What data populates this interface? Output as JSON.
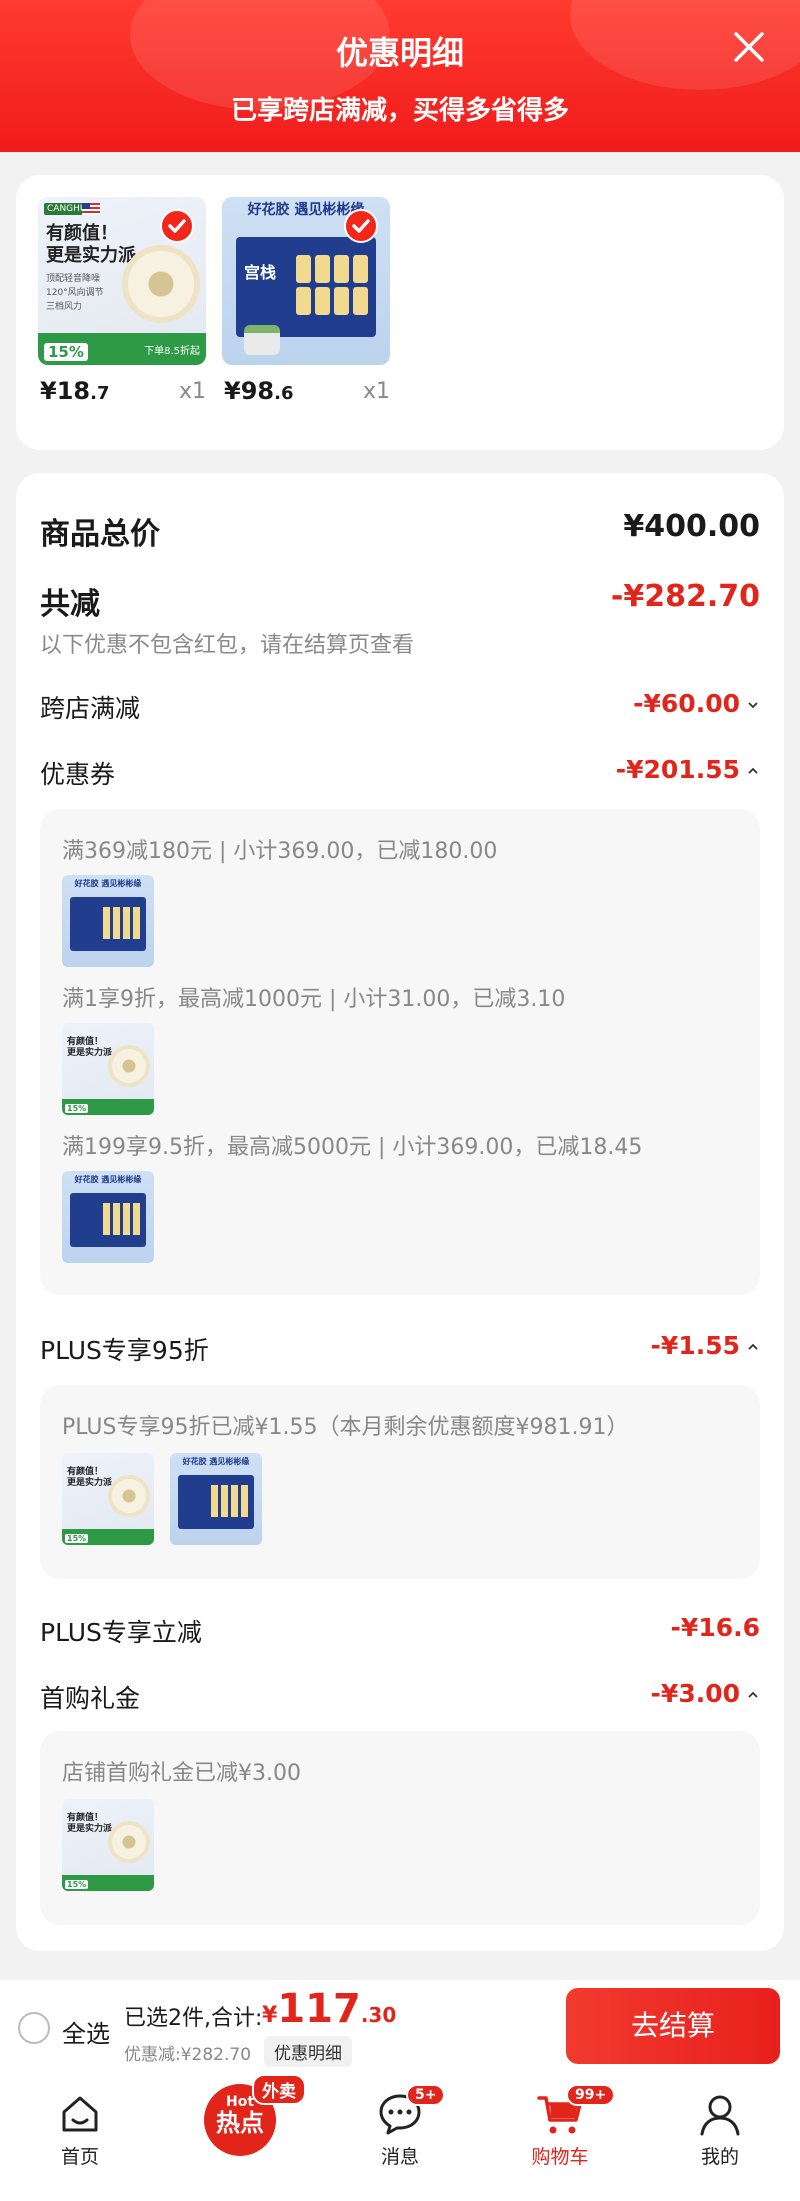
{
  "header": {
    "title": "优惠明细",
    "subtitle": "已享跨店满减，买得多省得多",
    "accent": "#f01b1b"
  },
  "products": [
    {
      "price_symbol": "¥",
      "price_int": "18",
      "price_dec": ".7",
      "qty": "x1",
      "checked": true,
      "art": {
        "brand": "CANGHUA",
        "headline_1": "有颜值！",
        "headline_2": "更是实力派",
        "bullets": [
          "顶配轻音降噪",
          "120°风向调节",
          "三档风力"
        ],
        "badge": "15%",
        "band_text": "下单8.5折起"
      }
    },
    {
      "price_symbol": "¥",
      "price_int": "98",
      "price_dec": ".6",
      "qty": "x1",
      "checked": true,
      "art": {
        "top_text": "好花胶 遇见彬彬缘",
        "pack_name": "宫栈"
      }
    }
  ],
  "summary": {
    "total_label": "商品总价",
    "total_value": "¥400.00",
    "reduce_label": "共减",
    "reduce_value": "-¥282.70",
    "reduce_note": "以下优惠不包含红包，请在结算页查看",
    "items": [
      {
        "label": "跨店满减",
        "value": "-¥60.00",
        "expanded": false
      },
      {
        "label": "优惠券",
        "value": "-¥201.55",
        "expanded": true
      },
      {
        "label": "PLUS专享95折",
        "value": "-¥1.55",
        "expanded": true
      },
      {
        "label": "PLUS专享立减",
        "value": "-¥16.6",
        "expanded": false
      },
      {
        "label": "首购礼金",
        "value": "-¥3.00",
        "expanded": true
      }
    ]
  },
  "coupon_panel": [
    {
      "text": "满369减180元 | 小计369.00，已减180.00",
      "product": "box"
    },
    {
      "text": "满1享9折，最高减1000元 | 小计31.00，已减3.10",
      "product": "fan"
    },
    {
      "text": "满199享9.5折，最高减5000元 | 小计369.00，已减18.45",
      "product": "box"
    }
  ],
  "plus_panel": {
    "text": "PLUS专享95折已减¥1.55（本月剩余优惠额度¥981.91）"
  },
  "gift_panel": {
    "text": "店铺首购礼金已减¥3.00"
  },
  "bottom_bar": {
    "select_all": "全选",
    "selected": "已选2件,合计:",
    "total_symbol": "¥",
    "total_int": "117",
    "total_dec": ".30",
    "discount": "优惠减:¥282.70",
    "detail_button": "优惠明细",
    "checkout": "去结算"
  },
  "tabs": [
    {
      "label": "首页",
      "icon": "home-icon"
    },
    {
      "label": "热点",
      "icon": "hot-icon",
      "hot_top": "Hot",
      "hot_main": "热点",
      "badge": "外卖"
    },
    {
      "label": "消息",
      "icon": "message-icon",
      "badge": "5+"
    },
    {
      "label": "购物车",
      "icon": "cart-icon",
      "badge": "99+",
      "active": true
    },
    {
      "label": "我的",
      "icon": "user-icon"
    }
  ]
}
